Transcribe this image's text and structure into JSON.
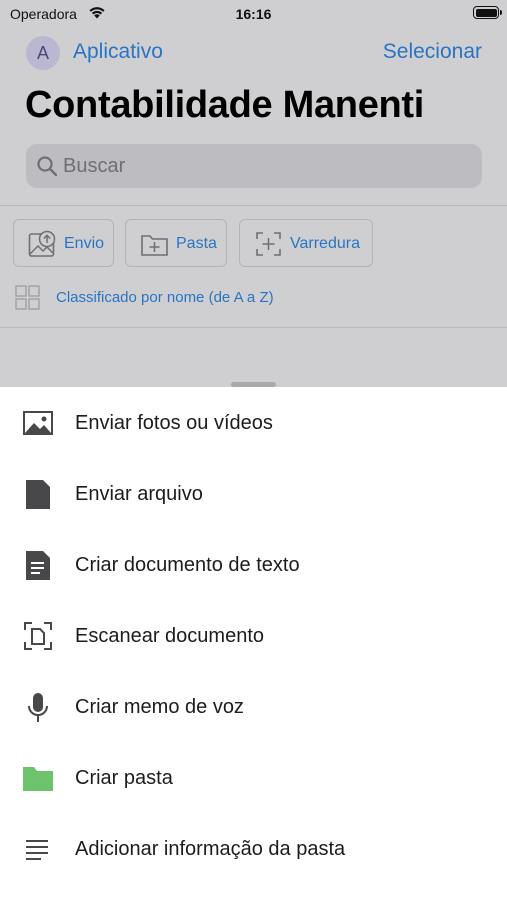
{
  "status_bar": {
    "carrier": "Operadora",
    "time": "16:16"
  },
  "nav": {
    "avatar_letter": "A",
    "back_label": "Aplicativo",
    "select_label": "Selecionar"
  },
  "page_title": "Contabilidade Manenti",
  "search": {
    "placeholder": "Buscar"
  },
  "actions": [
    {
      "label": "Envio",
      "icon": "upload-photo-icon"
    },
    {
      "label": "Pasta",
      "icon": "new-folder-icon"
    },
    {
      "label": "Varredura",
      "icon": "scan-icon"
    }
  ],
  "sort": {
    "label": "Classificado por nome (de A a Z)",
    "icon": "grid-view-icon"
  },
  "sheet": {
    "items": [
      {
        "label": "Enviar fotos ou vídeos",
        "icon": "photo-icon"
      },
      {
        "label": "Enviar arquivo",
        "icon": "file-icon"
      },
      {
        "label": "Criar documento de texto",
        "icon": "text-document-icon"
      },
      {
        "label": "Escanear documento",
        "icon": "scan-document-icon"
      },
      {
        "label": "Criar memo de voz",
        "icon": "microphone-icon"
      },
      {
        "label": "Criar pasta",
        "icon": "folder-icon"
      },
      {
        "label": "Adicionar informação da pasta",
        "icon": "lines-icon"
      }
    ]
  },
  "colors": {
    "accent": "#2a74c4",
    "folder_green": "#6cc36b",
    "dim_background": "#cfcfd1"
  }
}
